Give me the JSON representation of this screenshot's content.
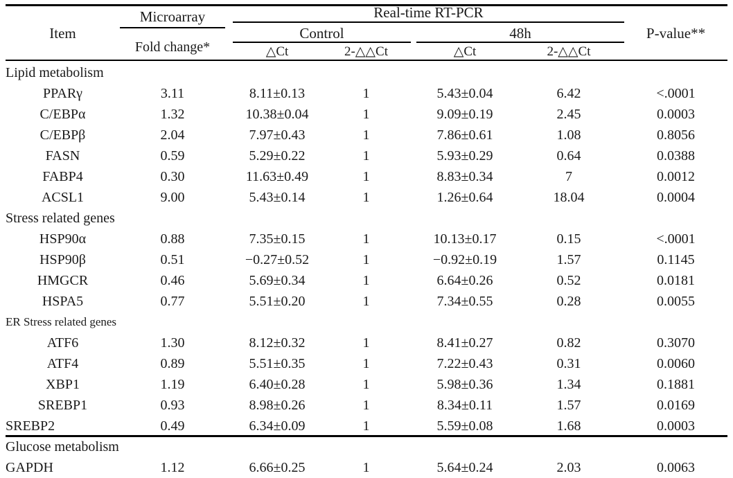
{
  "header": {
    "item": "Item",
    "microarray": "Microarray",
    "fold_change": "Fold  change*",
    "rtpcr": "Real-time  RT-PCR",
    "control": "Control",
    "treated": "48h",
    "p_value": "P-value**",
    "sub_dct": "△Ct",
    "sub_ddct": "2-△△Ct"
  },
  "rows": [
    {
      "kind": "section",
      "item": "Lipid metabolism"
    },
    {
      "kind": "data",
      "item": "PPARγ",
      "fold": "3.11",
      "cdct": "8.11±0.13",
      "cddct": "1",
      "tdct": "5.43±0.04",
      "tddct": "6.42",
      "p": "<.0001"
    },
    {
      "kind": "data",
      "item": "C/EBPα",
      "fold": "1.32",
      "cdct": "10.38±0.04",
      "cddct": "1",
      "tdct": "9.09±0.19",
      "tddct": "2.45",
      "p": "0.0003"
    },
    {
      "kind": "data",
      "item": "C/EBPβ",
      "fold": "2.04",
      "cdct": "7.97±0.43",
      "cddct": "1",
      "tdct": "7.86±0.61",
      "tddct": "1.08",
      "p": "0.8056"
    },
    {
      "kind": "data",
      "item": "FASN",
      "fold": "0.59",
      "cdct": "5.29±0.22",
      "cddct": "1",
      "tdct": "5.93±0.29",
      "tddct": "0.64",
      "p": "0.0388"
    },
    {
      "kind": "data",
      "item": "FABP4",
      "fold": "0.30",
      "cdct": "11.63±0.49",
      "cddct": "1",
      "tdct": "8.83±0.34",
      "tddct": "7",
      "p": "0.0012"
    },
    {
      "kind": "data",
      "item": "ACSL1",
      "fold": "9.00",
      "cdct": "5.43±0.14",
      "cddct": "1",
      "tdct": "1.26±0.64",
      "tddct": "18.04",
      "p": "0.0004"
    },
    {
      "kind": "section",
      "item": "Stress related genes"
    },
    {
      "kind": "data",
      "item": "HSP90α",
      "fold": "0.88",
      "cdct": "7.35±0.15",
      "cddct": "1",
      "tdct": "10.13±0.17",
      "tddct": "0.15",
      "p": "<.0001"
    },
    {
      "kind": "data",
      "item": "HSP90β",
      "fold": "0.51",
      "cdct": "−0.27±0.52",
      "cddct": "1",
      "tdct": "−0.92±0.19",
      "tddct": "1.57",
      "p": "0.1145"
    },
    {
      "kind": "data",
      "item": "HMGCR",
      "fold": "0.46",
      "cdct": "5.69±0.34",
      "cddct": "1",
      "tdct": "6.64±0.26",
      "tddct": "0.52",
      "p": "0.0181"
    },
    {
      "kind": "data",
      "item": "HSPA5",
      "fold": "0.77",
      "cdct": "5.51±0.20",
      "cddct": "1",
      "tdct": "7.34±0.55",
      "tddct": "0.28",
      "p": "0.0055"
    },
    {
      "kind": "section-small",
      "item": "ER Stress related genes"
    },
    {
      "kind": "data",
      "item": "ATF6",
      "fold": "1.30",
      "cdct": "8.12±0.32",
      "cddct": "1",
      "tdct": "8.41±0.27",
      "tddct": "0.82",
      "p": "0.3070"
    },
    {
      "kind": "data",
      "item": "ATF4",
      "fold": "0.89",
      "cdct": "5.51±0.35",
      "cddct": "1",
      "tdct": "7.22±0.43",
      "tddct": "0.31",
      "p": "0.0060"
    },
    {
      "kind": "data",
      "item": "XBP1",
      "fold": "1.19",
      "cdct": "6.40±0.28",
      "cddct": "1",
      "tdct": "5.98±0.36",
      "tddct": "1.34",
      "p": "0.1881"
    },
    {
      "kind": "data",
      "item": "SREBP1",
      "fold": "0.93",
      "cdct": "8.98±0.26",
      "cddct": "1",
      "tdct": "8.34±0.11",
      "tddct": "1.57",
      "p": "0.0169"
    },
    {
      "kind": "data-flush",
      "item": "SREBP2",
      "fold": "0.49",
      "cdct": "6.34±0.09",
      "cddct": "1",
      "tdct": "5.59±0.08",
      "tddct": "1.68",
      "p": "0.0003"
    },
    {
      "kind": "section",
      "item": "Glucose metabolism"
    },
    {
      "kind": "data-flush",
      "item": "GAPDH",
      "fold": "1.12",
      "cdct": "6.66±0.25",
      "cddct": "1",
      "tdct": "5.64±0.24",
      "tddct": "2.03",
      "p": "0.0063"
    }
  ]
}
